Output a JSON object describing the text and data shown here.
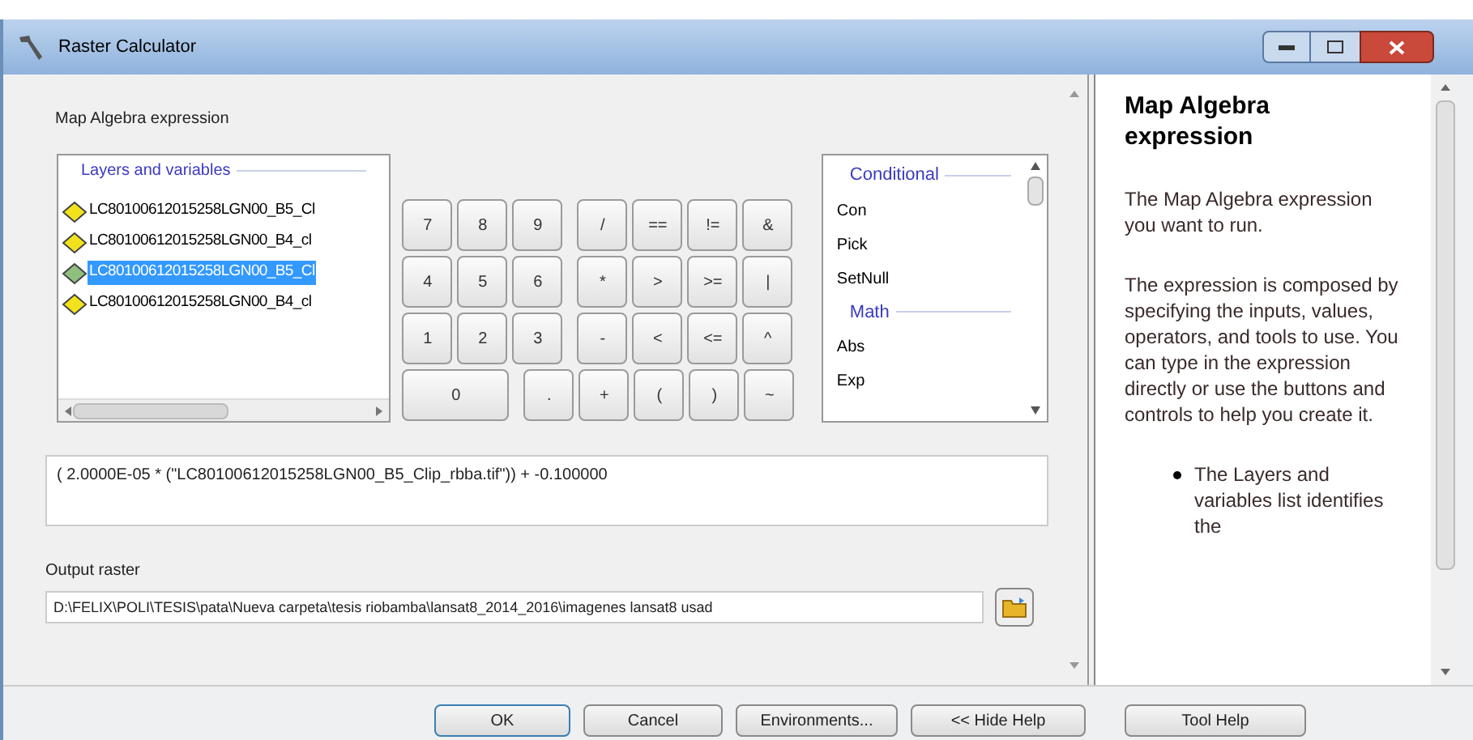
{
  "window": {
    "title": "Raster Calculator"
  },
  "expression_label": "Map Algebra expression",
  "layers": {
    "title": "Layers and variables",
    "items": [
      {
        "label": "LC80100612015258LGN00_B5_Cl",
        "selected": false,
        "color": "#f2e21c"
      },
      {
        "label": "LC80100612015258LGN00_B4_cl",
        "selected": false,
        "color": "#f2e21c"
      },
      {
        "label": "LC80100612015258LGN00_B5_Cl",
        "selected": true,
        "color": "#8fbf7f"
      },
      {
        "label": "LC80100612015258LGN00_B4_cl",
        "selected": false,
        "color": "#f2e21c"
      }
    ]
  },
  "keypad": [
    [
      "7",
      "8",
      "9",
      "/",
      "==",
      "!=",
      "&"
    ],
    [
      "4",
      "5",
      "6",
      "*",
      ">",
      ">=",
      "|"
    ],
    [
      "1",
      "2",
      "3",
      "-",
      "<",
      "<=",
      "^"
    ],
    [
      "0",
      ".",
      "+",
      "(",
      ")",
      "~"
    ]
  ],
  "functions": [
    {
      "kind": "header",
      "label": "Conditional"
    },
    {
      "kind": "item",
      "label": "Con"
    },
    {
      "kind": "item",
      "label": "Pick"
    },
    {
      "kind": "item",
      "label": "SetNull"
    },
    {
      "kind": "header",
      "label": "Math"
    },
    {
      "kind": "item",
      "label": "Abs"
    },
    {
      "kind": "item",
      "label": "Exp"
    }
  ],
  "expression": "( 2.0000E-05 * (\"LC80100612015258LGN00_B5_Clip_rbba.tif\")) + -0.100000",
  "output": {
    "label": "Output raster",
    "value": "D:\\FELIX\\POLI\\TESIS\\pata\\Nueva carpeta\\tesis riobamba\\lansat8_2014_2016\\imagenes lansat8 usad"
  },
  "help": {
    "title": "Map Algebra expression",
    "paragraphs": [
      "The Map Algebra expression you want to run.",
      "The expression is composed by specifying the inputs, values, operators, and tools to use. You can type in the expression directly or use the buttons and controls to help you create it."
    ],
    "bullets": [
      "The Layers and variables list identifies the"
    ]
  },
  "buttons": [
    "OK",
    "Cancel",
    "Environments...",
    "<< Hide Help",
    "Tool Help"
  ]
}
